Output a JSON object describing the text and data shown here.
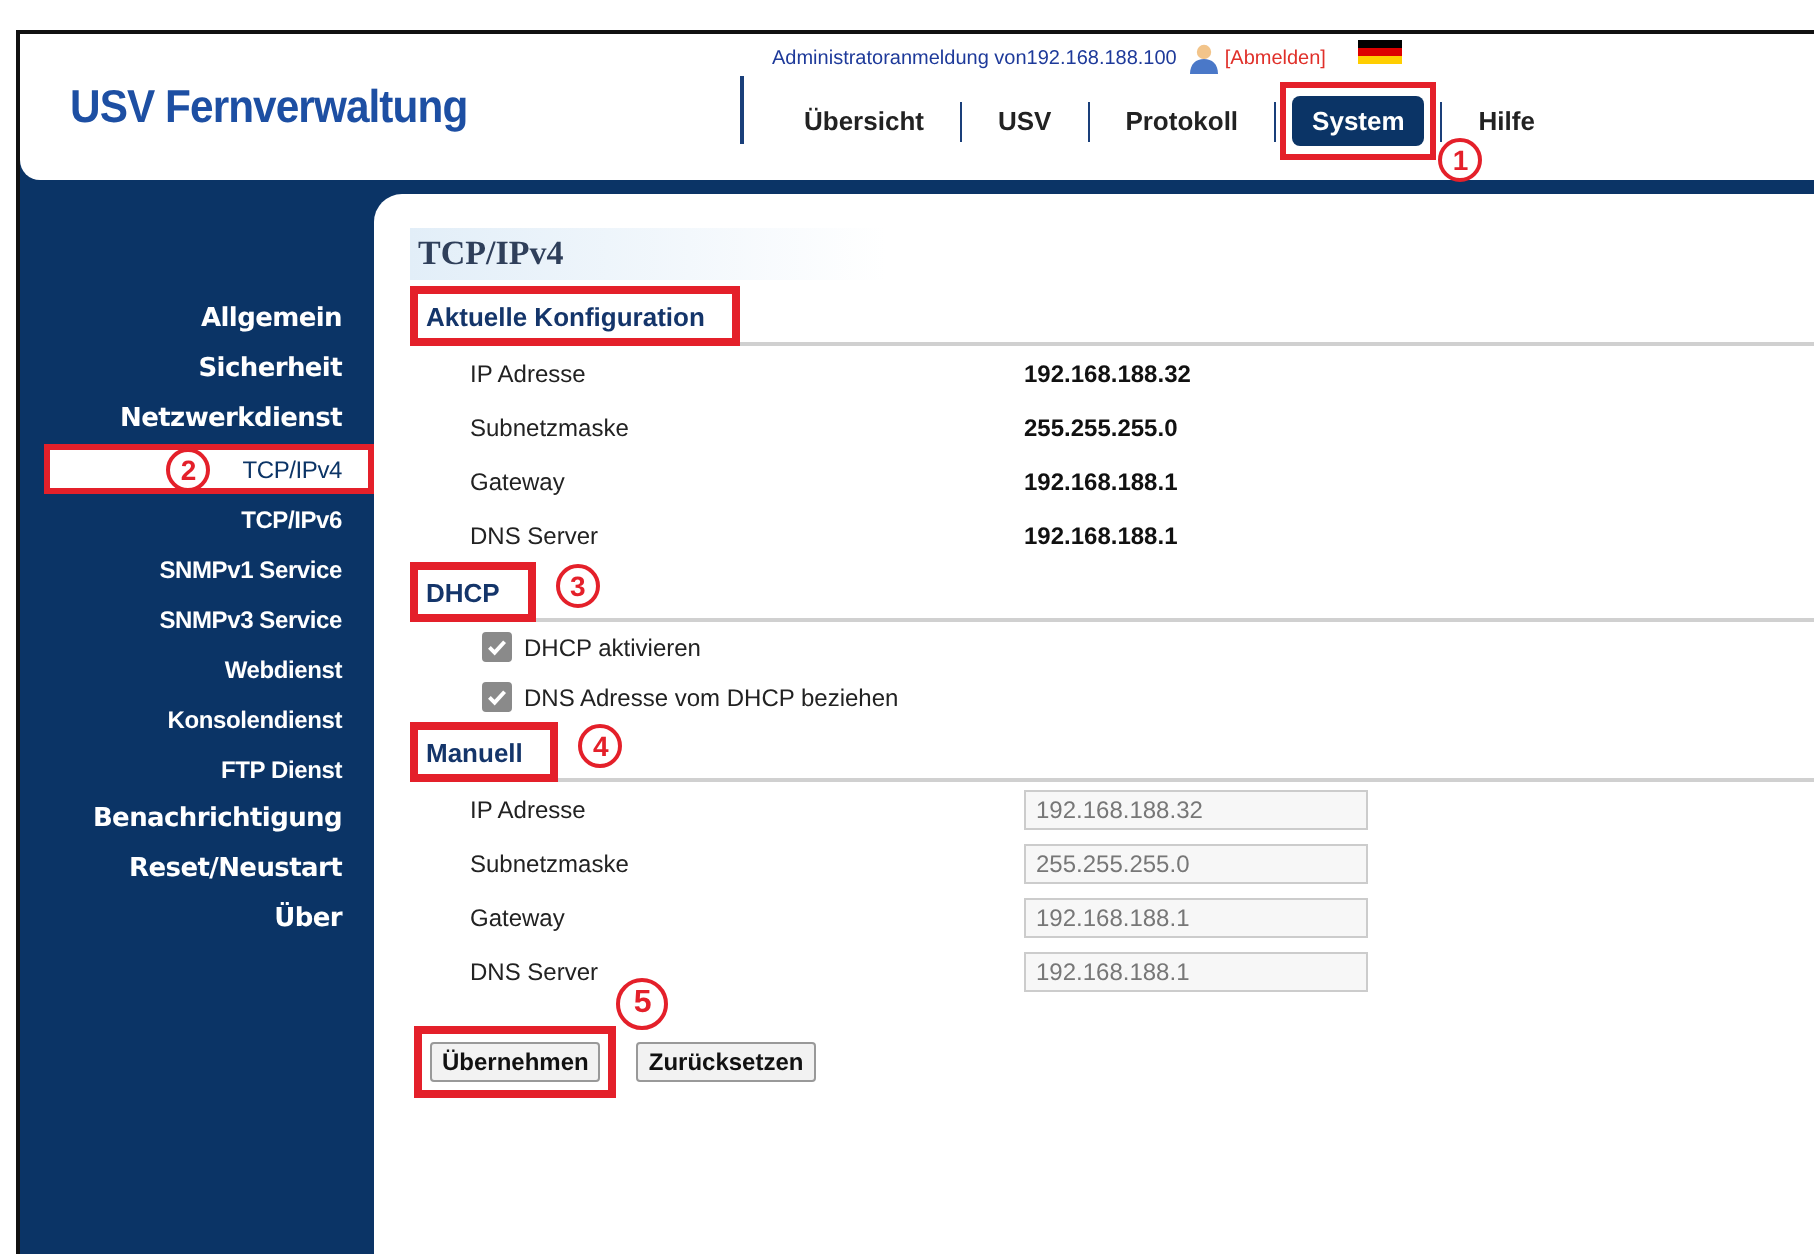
{
  "header": {
    "logo": "USV Fernverwaltung",
    "login_text": "Administratoranmeldung von192.168.188.100",
    "logout_link": "[Abmelden]",
    "nav": [
      {
        "label": "Übersicht",
        "selected": false,
        "highlighted": false
      },
      {
        "label": "USV",
        "selected": false,
        "highlighted": false
      },
      {
        "label": "Protokoll",
        "selected": false,
        "highlighted": false
      },
      {
        "label": "System",
        "selected": true,
        "highlighted": true,
        "marker": "1"
      },
      {
        "label": "Hilfe",
        "selected": false,
        "highlighted": false
      }
    ]
  },
  "sidebar": {
    "items": [
      {
        "label": "Allgemein",
        "kind": "section",
        "selected": false
      },
      {
        "label": "Sicherheit",
        "kind": "section",
        "selected": false
      },
      {
        "label": "Netzwerkdienst",
        "kind": "section",
        "selected": false
      },
      {
        "label": "TCP/IPv4",
        "kind": "sub",
        "selected": true,
        "marker": "2"
      },
      {
        "label": "TCP/IPv6",
        "kind": "sub",
        "selected": false
      },
      {
        "label": "SNMPv1 Service",
        "kind": "sub",
        "selected": false
      },
      {
        "label": "SNMPv3 Service",
        "kind": "sub",
        "selected": false
      },
      {
        "label": "Webdienst",
        "kind": "sub",
        "selected": false
      },
      {
        "label": "Konsolendienst",
        "kind": "sub",
        "selected": false
      },
      {
        "label": "FTP Dienst",
        "kind": "sub",
        "selected": false
      },
      {
        "label": "Benachrichtigung",
        "kind": "section",
        "selected": false
      },
      {
        "label": "Reset/Neustart",
        "kind": "section",
        "selected": false
      },
      {
        "label": "Über",
        "kind": "section",
        "selected": false
      }
    ]
  },
  "page": {
    "title": "TCP/IPv4",
    "sections": [
      {
        "heading": "Aktuelle Konfiguration",
        "highlighted": true,
        "kind": "readonly",
        "rows": [
          {
            "label": "IP Adresse",
            "value": "192.168.188.32"
          },
          {
            "label": "Subnetzmaske",
            "value": "255.255.255.0"
          },
          {
            "label": "Gateway",
            "value": "192.168.188.1"
          },
          {
            "label": "DNS Server",
            "value": "192.168.188.1"
          }
        ]
      },
      {
        "heading": "DHCP",
        "highlighted": true,
        "marker": "3",
        "kind": "checkboxes",
        "items": [
          {
            "label": "DHCP aktivieren",
            "checked": true
          },
          {
            "label": "DNS Adresse vom DHCP beziehen",
            "checked": true
          }
        ]
      },
      {
        "heading": "Manuell",
        "highlighted": true,
        "marker": "4",
        "kind": "fields",
        "rows": [
          {
            "label": "IP Adresse",
            "value": "192.168.188.32",
            "disabled": true
          },
          {
            "label": "Subnetzmaske",
            "value": "255.255.255.0",
            "disabled": true
          },
          {
            "label": "Gateway",
            "value": "192.168.188.1",
            "disabled": true
          },
          {
            "label": "DNS Server",
            "value": "192.168.188.1",
            "disabled": true
          }
        ]
      }
    ],
    "buttons": [
      {
        "label": "Übernehmen",
        "highlighted": true,
        "marker": "5"
      },
      {
        "label": "Zurücksetzen",
        "highlighted": false
      }
    ]
  }
}
